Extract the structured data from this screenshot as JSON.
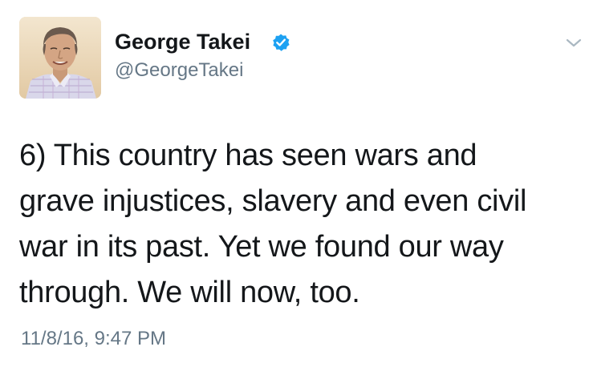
{
  "tweet": {
    "author": {
      "display_name": "George Takei",
      "handle": "@GeorgeTakei",
      "verified": true
    },
    "text_lines": [
      "6) This country has seen wars and",
      "grave injustices, slavery and even civil",
      "war in its past. Yet we found our way",
      "through. We will now, too."
    ],
    "timestamp": "11/8/16, 9:47 PM"
  },
  "icons": {
    "verified": "verified-badge-icon",
    "menu": "chevron-down-icon"
  },
  "colors": {
    "text_primary": "#14171a",
    "text_secondary": "#657786",
    "verified_blue": "#1da1f2",
    "chevron": "#aab8c2"
  }
}
